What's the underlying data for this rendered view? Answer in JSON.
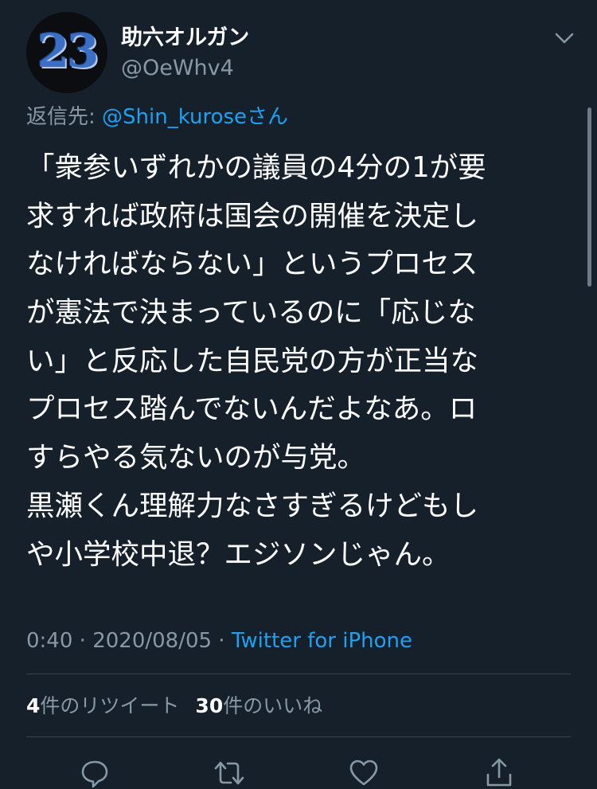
{
  "author": {
    "avatar_text": "23",
    "display_name": "助六オルガン",
    "handle": "@OeWhv4"
  },
  "reply": {
    "prefix": "返信先: ",
    "mention": "@Shin_kurose",
    "suffix": "さん"
  },
  "tweet": {
    "lines": [
      "「衆参いずれかの議員の4分の1が要",
      "求すれば政府は国会の開催を決定し",
      "なければならない」というプロセス",
      "が憲法で決まっているのに「応じな",
      "い」と反応した自民党の方が正当な",
      "プロセス踏んでないんだよなあ。ロ",
      "すらやる気ないのが与党。",
      "黒瀬くん理解力なさすぎるけどもし",
      "や小学校中退？エジソンじゃん。"
    ]
  },
  "meta": {
    "time": "0:40",
    "separator1": " · ",
    "date": "2020/08/05",
    "separator2": " · ",
    "source": "Twitter for iPhone"
  },
  "stats": {
    "retweets_count": "4",
    "retweets_label": "件のリツイート",
    "likes_count": "30",
    "likes_label": "件のいいね"
  },
  "actions": [
    {
      "icon": "reply-icon"
    },
    {
      "icon": "retweet-icon"
    },
    {
      "icon": "like-icon"
    },
    {
      "icon": "share-icon"
    }
  ],
  "colors": {
    "background": "#15202b",
    "accent": "#1da1f2",
    "secondary_text": "#8899a6",
    "divider": "#38444d"
  }
}
